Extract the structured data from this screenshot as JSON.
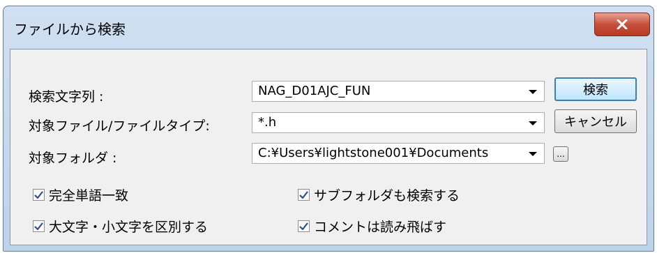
{
  "window": {
    "title": "ファイルから検索",
    "close_label": "x"
  },
  "form": {
    "search_label": "検索文字列 :",
    "search_value": "NAG_D01AJC_FUN",
    "filetype_label": "対象ファイル/ファイルタイプ:",
    "filetype_value": "*.h",
    "folder_label": "対象フォルダ :",
    "folder_value": "C:¥Users¥lightstone001¥Documents",
    "browse_label": "..."
  },
  "buttons": {
    "search": "検索",
    "cancel": "キャンセル"
  },
  "options": [
    {
      "label": "完全単語一致",
      "checked": true
    },
    {
      "label": "サブフォルダも検索する",
      "checked": true
    },
    {
      "label": "大文字・小文字を区別する",
      "checked": true
    },
    {
      "label": "コメントは読み飛ばす",
      "checked": true
    }
  ],
  "colors": {
    "title_bar": "#c3d7ed",
    "close_button": "#c7503a",
    "client_bg": "#f0f0f0",
    "default_button_border": "#3c7fb1",
    "check_mark": "#2d4f8a"
  }
}
